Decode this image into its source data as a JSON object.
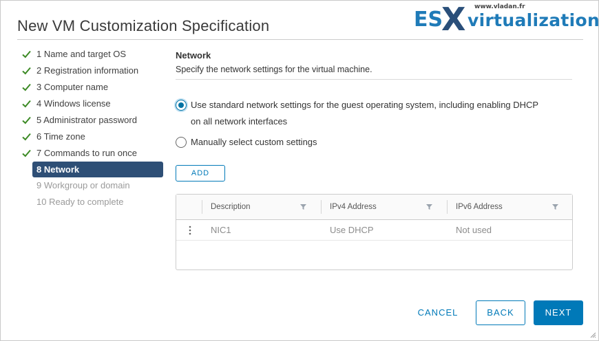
{
  "dialog": {
    "title": "New VM Customization Specification"
  },
  "watermark": {
    "brand_left": "ES",
    "brand_x": "X",
    "brand_right": "virtualization",
    "url": "www.vladan.fr"
  },
  "steps": [
    {
      "label": "1 Name and target OS",
      "state": "completed"
    },
    {
      "label": "2 Registration information",
      "state": "completed"
    },
    {
      "label": "3 Computer name",
      "state": "completed"
    },
    {
      "label": "4 Windows license",
      "state": "completed"
    },
    {
      "label": "5 Administrator password",
      "state": "completed"
    },
    {
      "label": "6 Time zone",
      "state": "completed"
    },
    {
      "label": "7 Commands to run once",
      "state": "completed"
    },
    {
      "label": "8 Network",
      "state": "active"
    },
    {
      "label": "9 Workgroup or domain",
      "state": "pending"
    },
    {
      "label": "10 Ready to complete",
      "state": "pending"
    }
  ],
  "section": {
    "title": "Network",
    "description": "Specify the network settings for the virtual machine."
  },
  "options": {
    "standard_line1": "Use standard network settings for the guest operating system, including enabling DHCP",
    "standard_line2": "on all network interfaces",
    "standard_selected": true,
    "custom": "Manually select custom settings",
    "custom_selected": false
  },
  "add_button": "ADD",
  "grid": {
    "columns": [
      "Description",
      "IPv4 Address",
      "IPv6 Address"
    ],
    "rows": [
      {
        "description": "NIC1",
        "ipv4": "Use DHCP",
        "ipv6": "Not used"
      }
    ]
  },
  "footer": {
    "cancel": "CANCEL",
    "back": "BACK",
    "next": "NEXT"
  },
  "colors": {
    "accent": "#0079b8",
    "active_step_bg": "#2e4f76",
    "check_green": "#3c8a25"
  },
  "icons": {
    "completed": "check-icon",
    "filter": "filter-icon",
    "row_actions": "kebab-icon"
  }
}
